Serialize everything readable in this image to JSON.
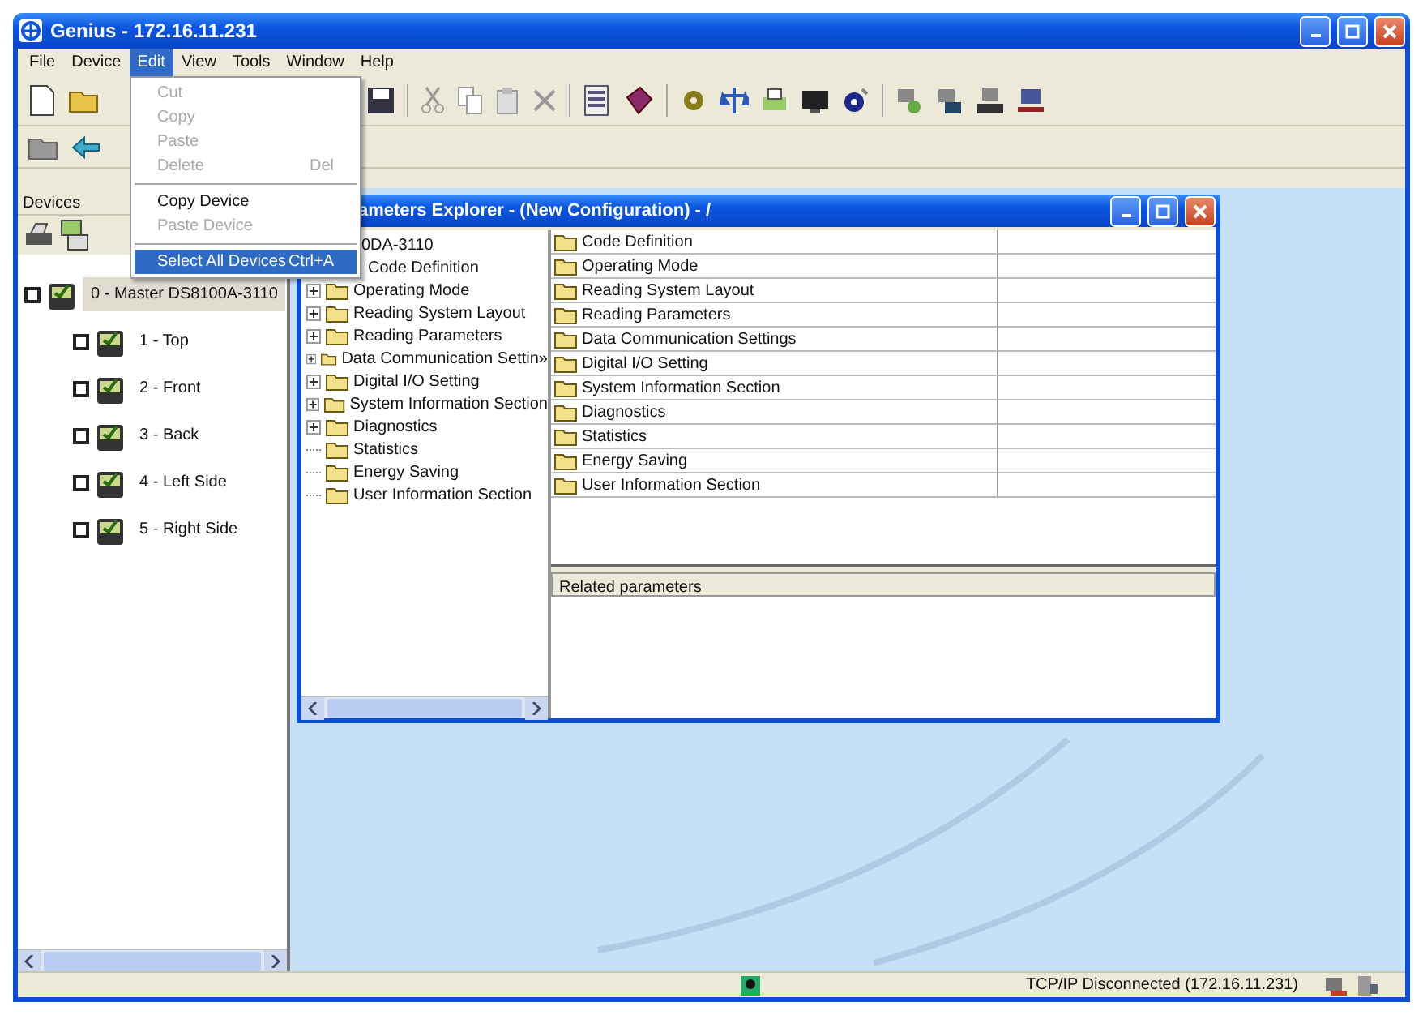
{
  "window": {
    "title": "Genius - 172.16.11.231"
  },
  "menu_bar": [
    {
      "label": "File",
      "selected": false
    },
    {
      "label": "Device",
      "selected": false
    },
    {
      "label": "Edit",
      "selected": true
    },
    {
      "label": "View",
      "selected": false
    },
    {
      "label": "Tools",
      "selected": false
    },
    {
      "label": "Window",
      "selected": false
    },
    {
      "label": "Help",
      "selected": false
    }
  ],
  "edit_menu": [
    {
      "kind": "item",
      "label": "Cut",
      "disabled": true,
      "selected": false
    },
    {
      "kind": "item",
      "label": "Copy",
      "disabled": true,
      "selected": false
    },
    {
      "kind": "item",
      "label": "Paste",
      "disabled": true,
      "selected": false
    },
    {
      "kind": "item",
      "label": "Delete",
      "shortcut": "Del",
      "disabled": true,
      "selected": false
    },
    {
      "kind": "separator"
    },
    {
      "kind": "item",
      "label": "Copy Device",
      "disabled": false,
      "selected": false
    },
    {
      "kind": "item",
      "label": "Paste Device",
      "disabled": true,
      "selected": false
    },
    {
      "kind": "separator"
    },
    {
      "kind": "item",
      "label": "Select All Devices",
      "shortcut": "Ctrl+A",
      "disabled": false,
      "selected": true
    }
  ],
  "devices_panel": {
    "title": "Devices",
    "tree": [
      {
        "label": "0 - Master DS8100A-3110",
        "checked": false,
        "selected": true,
        "children": [
          {
            "label": "1 - Top",
            "checked": false,
            "selected": false
          },
          {
            "label": "2 - Front",
            "checked": false,
            "selected": false
          },
          {
            "label": "3 - Back",
            "checked": false,
            "selected": false
          },
          {
            "label": "4 - Left Side",
            "checked": false,
            "selected": false
          },
          {
            "label": "5 - Right Side",
            "checked": false,
            "selected": false
          }
        ]
      }
    ]
  },
  "explorer_window": {
    "title": "ameters Explorer - (New Configuration) - /",
    "tree": [
      {
        "label": "0DA-3110"
      },
      {
        "label": "Code Definition"
      },
      {
        "label": "Operating Mode",
        "expandable": true
      },
      {
        "label": "Reading System Layout",
        "expandable": true
      },
      {
        "label": "Reading Parameters",
        "expandable": true
      },
      {
        "label": "Data Communication Settin»",
        "expandable": true
      },
      {
        "label": "Digital I/O Setting",
        "expandable": true
      },
      {
        "label": "System Information Section",
        "expandable": true
      },
      {
        "label": "Diagnostics",
        "expandable": true
      },
      {
        "label": "Statistics",
        "expandable": false
      },
      {
        "label": "Energy Saving",
        "expandable": false
      },
      {
        "label": "User Information Section",
        "expandable": false
      }
    ],
    "list_rows": [
      "Code Definition",
      "Operating Mode",
      "Reading System Layout",
      "Reading Parameters",
      "Data Communication Settings",
      "Digital I/O Setting",
      "System Information Section",
      "Diagnostics",
      "Statistics",
      "Energy Saving",
      "User Information Section"
    ],
    "related_header": "Related parameters"
  },
  "status_bar": {
    "text": "TCP/IP Disconnected (172.16.11.231)"
  }
}
